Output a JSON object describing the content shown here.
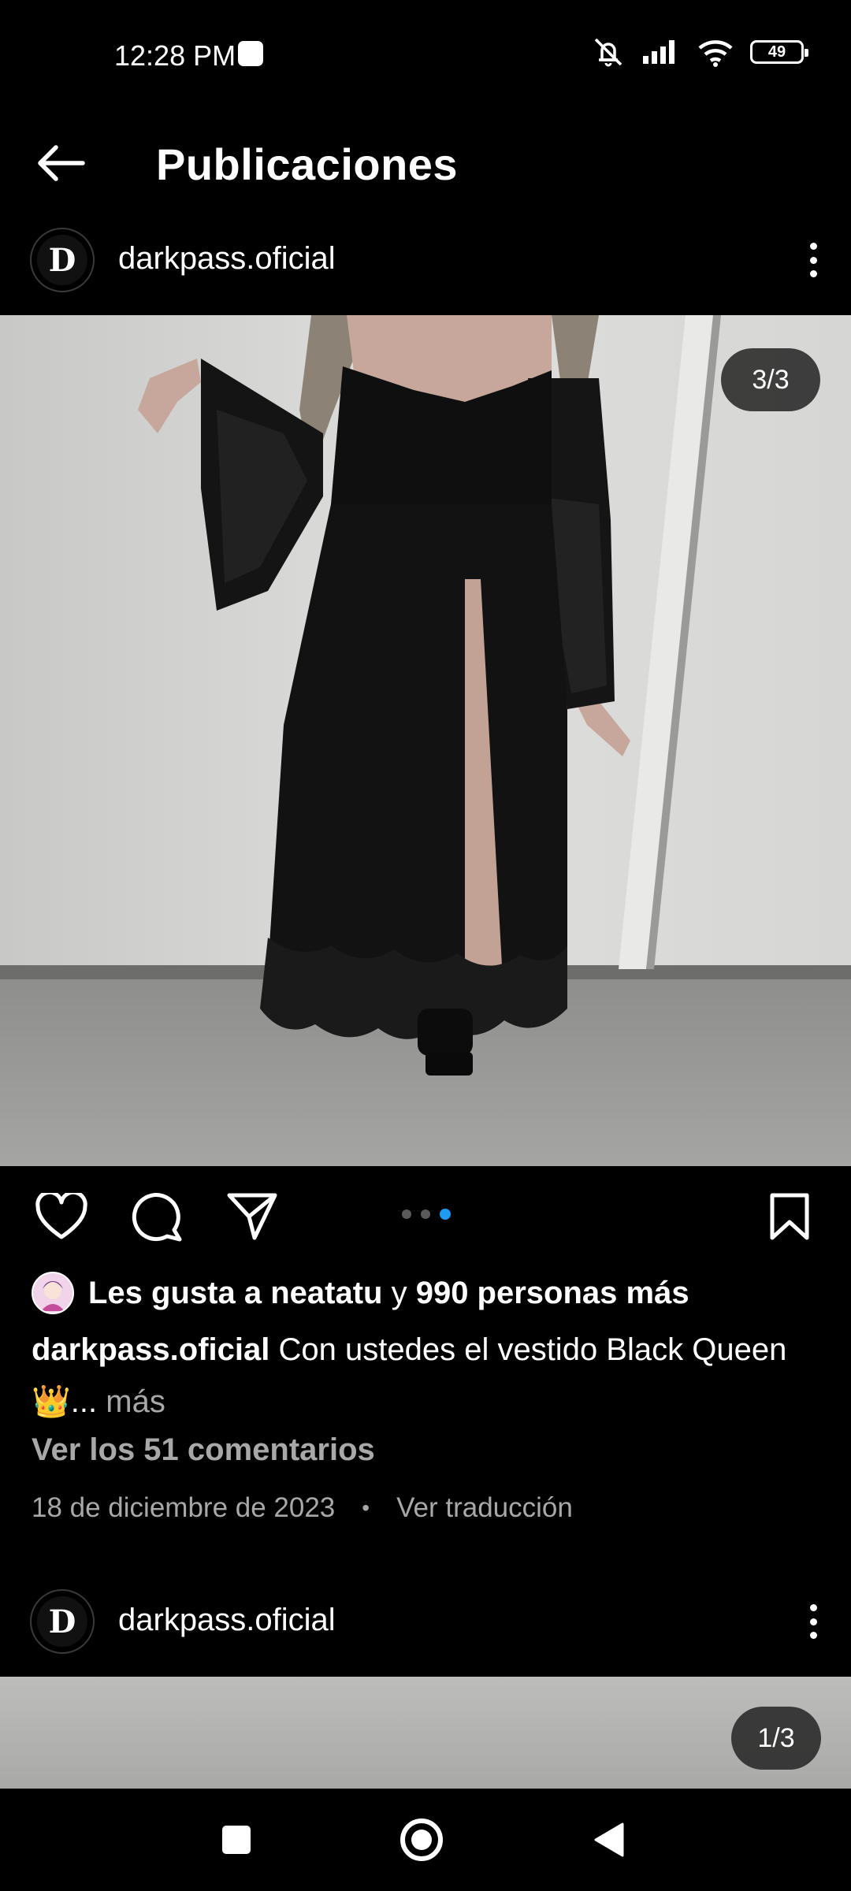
{
  "status_bar": {
    "time": "12:28 PM",
    "battery": "49",
    "icons": [
      "mute-icon",
      "signal-icon",
      "wifi-icon",
      "battery-icon"
    ]
  },
  "app_bar": {
    "title": "Publicaciones",
    "back_icon": "arrow-left-icon"
  },
  "post": {
    "username": "darkpass.oficial",
    "avatar_letter": "D",
    "counter": "3/3",
    "carousel": {
      "count": 3,
      "active_index": 3
    },
    "likes": {
      "prefix": "Les gusta a",
      "user": "neatatu",
      "joiner": "y",
      "count_text": "990 personas más"
    },
    "caption": {
      "username": "darkpass.oficial",
      "text": "Con ustedes el vestido Black Queen 👑...",
      "more": "más"
    },
    "comments_link": "Ver los 51 comentarios",
    "date": "18 de diciembre de 2023",
    "separator": "•",
    "translate_link": "Ver traducción"
  },
  "next_post": {
    "username": "darkpass.oficial",
    "avatar_letter": "D",
    "counter": "1/3"
  },
  "colors": {
    "background": "#000000",
    "muted_text": "#a8a8a8",
    "active_dot": "#1d9bf0"
  }
}
